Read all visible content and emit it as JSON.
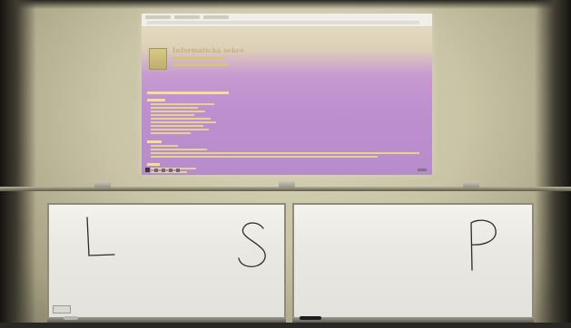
{
  "projection": {
    "site_title": "Informatická sekce"
  },
  "whiteboards": {
    "left_letters": [
      "L",
      "S"
    ],
    "right_letters": [
      "P"
    ]
  }
}
